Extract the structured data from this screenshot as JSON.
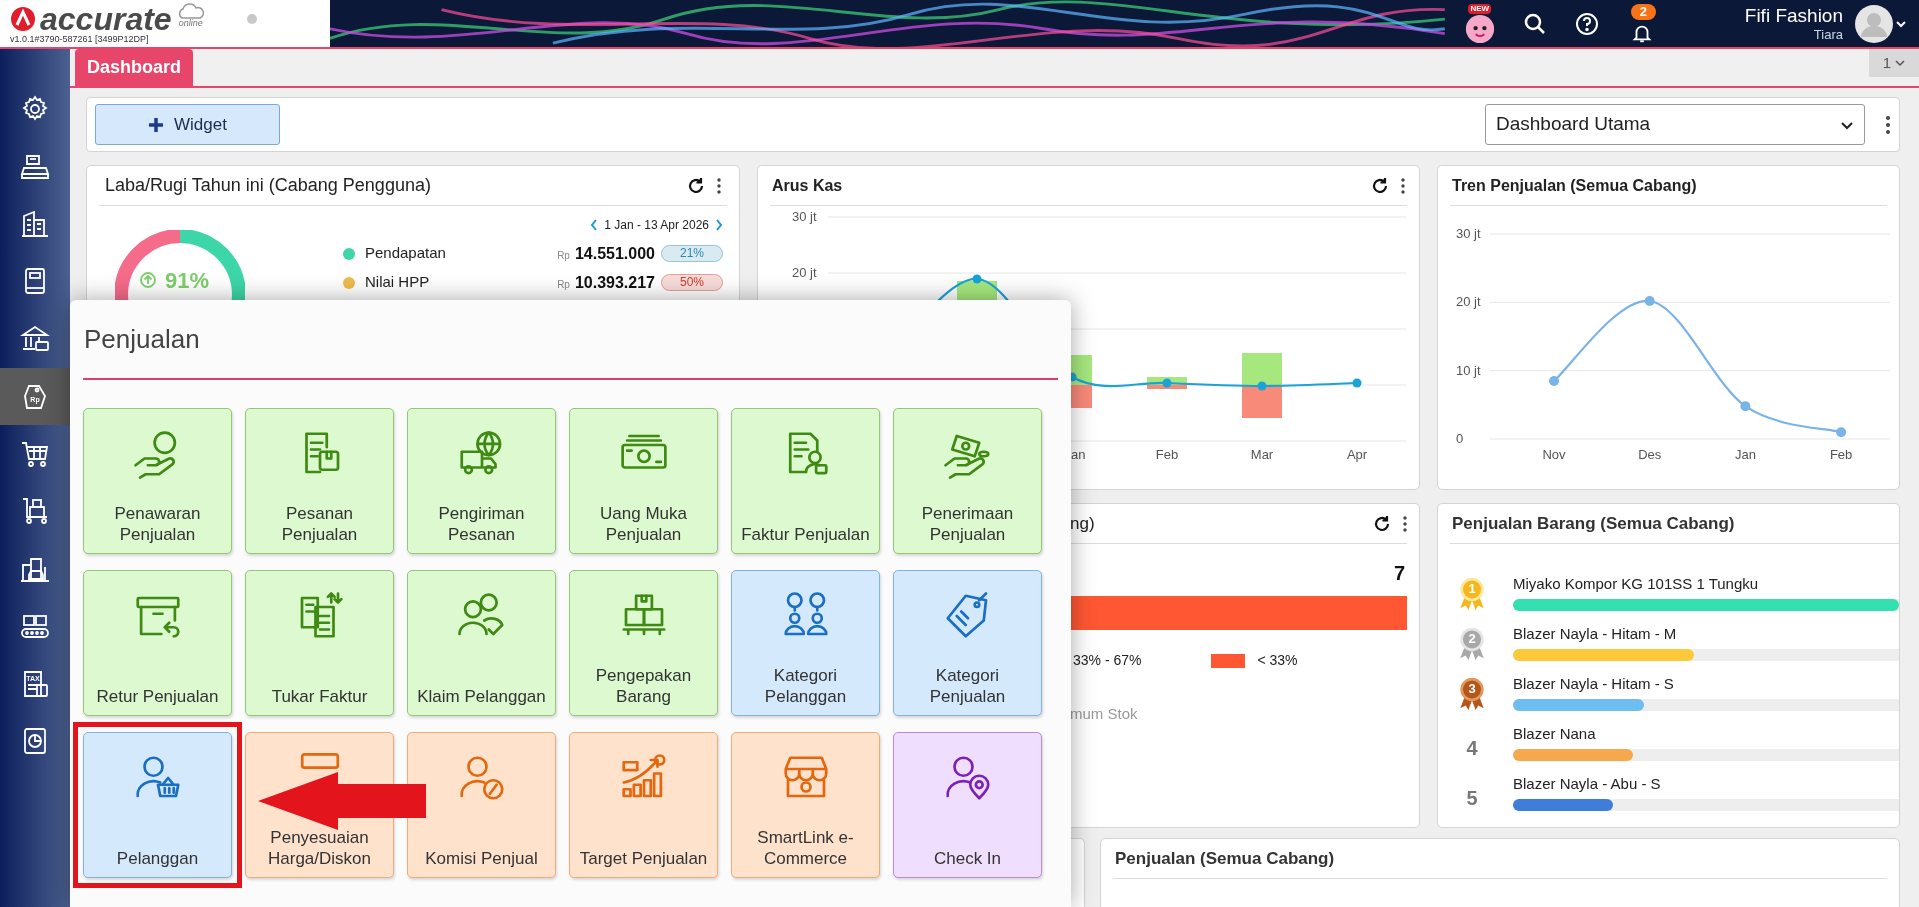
{
  "header": {
    "logo_text": "accurate",
    "logo_sub": "online",
    "version": "v1.0.1#3790-587261 [3499P12DP]",
    "new_badge": "NEW",
    "notification_count": "2",
    "company": "Fifi Fashion",
    "user": "Tiara"
  },
  "tabs": [
    {
      "label": "Dashboard",
      "selected": true
    }
  ],
  "page_number": "1",
  "sidebar": {
    "items": [
      {
        "selected": false
      },
      {
        "selected": false
      },
      {
        "selected": false
      },
      {
        "selected": false
      },
      {
        "selected": false
      },
      {
        "selected": true,
        "icon_text": "Rp"
      },
      {
        "selected": false
      },
      {
        "selected": false
      },
      {
        "selected": false
      },
      {
        "selected": false
      },
      {
        "selected": false,
        "icon_text": "TAX"
      },
      {
        "selected": false
      }
    ]
  },
  "toolbar": {
    "add_button": "Widget",
    "dashboard_select": "Dashboard Utama"
  },
  "widgets": {
    "profit_loss": {
      "title": "Laba/Rugi Tahun ini (Cabang Pengguna)",
      "period": "1 Jan - 13 Apr 2026",
      "ratio": "91%",
      "rows": [
        {
          "label": "Pendapatan",
          "color": "#3dd6a8",
          "currency": "Rp",
          "amount": "14.551.000",
          "badge": {
            "text": "21%",
            "color": "#2a8ab0"
          }
        },
        {
          "label": "Nilai HPP",
          "color": "#eebc4e",
          "currency": "Rp",
          "amount": "10.393.217",
          "badge": {
            "text": "50%",
            "color": "#d03a2a"
          }
        }
      ]
    },
    "cash_flow": {
      "title": "Arus Kas",
      "y_labels": [
        "30 jt",
        "20 jt"
      ],
      "x_labels": [
        "an",
        "Feb",
        "Mar",
        "Apr"
      ]
    },
    "sales_trend": {
      "title": "Tren Penjualan (Semua Cabang)",
      "chart_data": {
        "type": "line",
        "categories": [
          "Nov",
          "Des",
          "Jan",
          "Feb"
        ],
        "series": [
          {
            "color": "#7ab3e8",
            "marker": "circle",
            "values": [
              8.5,
              20.2,
              4.8,
              1
            ]
          }
        ],
        "ylim": [
          0,
          30
        ],
        "yticks": [
          {
            "value": 0,
            "label": "0"
          },
          {
            "value": 10,
            "label": "10 jt"
          },
          {
            "value": 20,
            "label": "20 jt"
          },
          {
            "value": 30,
            "label": "30 jt"
          }
        ]
      }
    },
    "stock": {
      "title": "ng)",
      "value": "7",
      "legend": [
        {
          "label": "33% - 67%"
        },
        {
          "label": "< 33%",
          "color": "#ff5733"
        }
      ],
      "note": "mum Stok"
    },
    "top_items": {
      "title": "Penjualan Barang (Semua Cabang)",
      "items": [
        {
          "kind": "gold",
          "rank": "1",
          "name": "Miyako Kompor KG 101SS 1 Tungku",
          "level": 1,
          "color": "#34e0b0"
        },
        {
          "kind": "silver",
          "rank": "2",
          "name": "Blazer Nayla - Hitam - M",
          "level": 0.47,
          "color": "#fcc93a"
        },
        {
          "kind": "bronze",
          "rank": "3",
          "name": "Blazer Nayla - Hitam - S",
          "level": 0.34,
          "color": "#6dbdf0"
        },
        {
          "kind": "plain",
          "rank": "4",
          "name": "Blazer Nana",
          "level": 0.31,
          "color": "#f8a84c"
        },
        {
          "kind": "plain",
          "rank": "5",
          "name": "Blazer Nayla - Abu - S",
          "level": 0.26,
          "color": "#3f7ed8"
        }
      ]
    },
    "sales": {
      "title": "Penjualan (Semua Cabang)"
    }
  },
  "menu": {
    "title": "Penjualan",
    "tiles": [
      {
        "label": "Penawaran Penjualan",
        "color": "#dcf9cf",
        "icon": {
          "color": "#3f8a12"
        },
        "highlighted": false
      },
      {
        "label": "Pesanan Penjualan",
        "color": "#dcf9cf",
        "icon": {
          "color": "#3f8a12"
        },
        "highlighted": false
      },
      {
        "label": "Pengiriman Pesanan",
        "color": "#dcf9cf",
        "icon": {
          "color": "#3f8a12"
        },
        "highlighted": false
      },
      {
        "label": "Uang Muka Penjualan",
        "color": "#dcf9cf",
        "icon": {
          "color": "#3f8a12"
        },
        "highlighted": false
      },
      {
        "label": "Faktur Penjualan",
        "color": "#dcf9cf",
        "icon": {
          "color": "#3f8a12"
        },
        "highlighted": false
      },
      {
        "label": "Penerimaan Penjualan",
        "color": "#dcf9cf",
        "icon": {
          "color": "#3f8a12"
        },
        "highlighted": false
      },
      {
        "label": "Retur Penjualan",
        "color": "#dcf9cf",
        "icon": {
          "color": "#3f8a12"
        },
        "highlighted": false
      },
      {
        "label": "Tukar Faktur",
        "color": "#dcf9cf",
        "icon": {
          "color": "#3f8a12"
        },
        "highlighted": false
      },
      {
        "label": "Klaim Pelanggan",
        "color": "#dcf9cf",
        "icon": {
          "color": "#3f8a12"
        },
        "highlighted": false
      },
      {
        "label": "Pengepakan Barang",
        "color": "#dcf9cf",
        "icon": {
          "color": "#3f8a12"
        },
        "highlighted": false
      },
      {
        "label": "Kategori Pelanggan",
        "color": "#d5e9fd",
        "icon": {
          "color": "#1a6fc4"
        },
        "highlighted": false
      },
      {
        "label": "Kategori Penjualan",
        "color": "#d5e9fd",
        "icon": {
          "color": "#1a6fc4"
        },
        "highlighted": false
      },
      {
        "label": "Pelanggan",
        "color": "#d5e9fd",
        "icon": {
          "color": "#1a6fc4"
        },
        "highlighted": true
      },
      {
        "label": "Penyesuaian Harga/Diskon",
        "color": "#ffe2cc",
        "icon": {
          "color": "#e4670e"
        },
        "highlighted": false
      },
      {
        "label": "Komisi Penjual",
        "color": "#ffe2cc",
        "icon": {
          "color": "#e4670e"
        },
        "highlighted": false
      },
      {
        "label": "Target Penjualan",
        "color": "#ffe2cc",
        "icon": {
          "color": "#e4670e"
        },
        "highlighted": false
      },
      {
        "label": "SmartLink e-Commerce",
        "color": "#ffe2cc",
        "icon": {
          "color": "#e4670e"
        },
        "highlighted": false
      },
      {
        "label": "Check In",
        "color": "#efdefd",
        "icon": {
          "color": "#7b22b6"
        },
        "highlighted": false
      }
    ]
  }
}
